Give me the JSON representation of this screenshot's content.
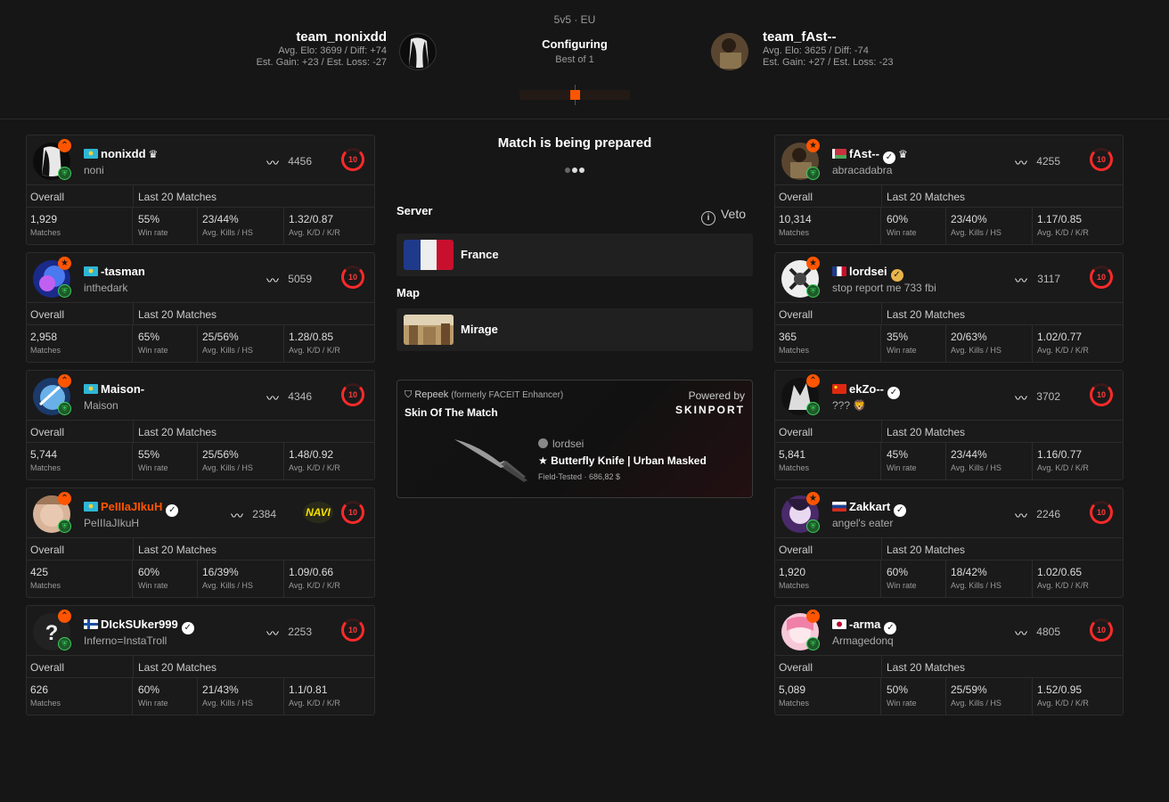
{
  "header": {
    "mode": "5v5 · EU",
    "status": "Configuring",
    "best_of": "Best of 1",
    "team_left": {
      "name": "team_nonixdd",
      "stat1": "Avg. Elo: 3699 / Diff: +74",
      "stat2": "Est. Gain: +23 / Est. Loss: -27"
    },
    "team_right": {
      "name": "team_fAst--",
      "stat1": "Avg. Elo: 3625 / Diff: -74",
      "stat2": "Est. Gain: +27 / Est. Loss: -23"
    }
  },
  "labels": {
    "overall": "Overall",
    "last20": "Last 20 Matches",
    "matches": "Matches",
    "win_rate": "Win rate",
    "avg_kills_hs": "Avg. Kills / HS",
    "avg_kd_kr": "Avg. K/D / K/R",
    "level": "10"
  },
  "left_players": [
    {
      "name": "nonixdd",
      "desc": "noni",
      "elo": "4456",
      "matches": "1,929",
      "win_rate": "55%",
      "kills_hs": "23/44%",
      "kd_kr": "1.32/0.87",
      "flag": "kz",
      "verified": "",
      "crown": true,
      "rank_icon": "chevrons-up-icon"
    },
    {
      "name": "-tasman",
      "desc": "inthedark",
      "elo": "5059",
      "matches": "2,958",
      "win_rate": "65%",
      "kills_hs": "25/56%",
      "kd_kr": "1.28/0.85",
      "flag": "kz",
      "verified": "",
      "crown": false,
      "rank_icon": "star-icon"
    },
    {
      "name": "Maison-",
      "desc": "Maison",
      "elo": "4346",
      "matches": "5,744",
      "win_rate": "55%",
      "kills_hs": "25/56%",
      "kd_kr": "1.48/0.92",
      "flag": "kz",
      "verified": "",
      "crown": false,
      "rank_icon": "chevrons-up-icon"
    },
    {
      "name": "PeIIIaJIkuH",
      "desc": "PeIIIaJIkuH",
      "elo": "2384",
      "matches": "425",
      "win_rate": "60%",
      "kills_hs": "16/39%",
      "kd_kr": "1.09/0.66",
      "flag": "kz",
      "verified": "white",
      "crown": false,
      "rank_icon": "chevrons-up-icon",
      "team_logo": "NAVI"
    },
    {
      "name": "DIckSUker999",
      "desc": "Inferno=InstaTroll",
      "elo": "2253",
      "matches": "626",
      "win_rate": "60%",
      "kills_hs": "21/43%",
      "kd_kr": "1.1/0.81",
      "flag": "fi",
      "verified": "white",
      "crown": false,
      "rank_icon": "chevrons-up-icon"
    }
  ],
  "right_players": [
    {
      "name": "fAst--",
      "desc": "abracadabra",
      "elo": "4255",
      "matches": "10,314",
      "win_rate": "60%",
      "kills_hs": "23/40%",
      "kd_kr": "1.17/0.85",
      "flag": "by",
      "verified": "white",
      "crown": true,
      "rank_icon": "star-icon"
    },
    {
      "name": "lordsei",
      "desc": "stop report me 733 fbi",
      "elo": "3117",
      "matches": "365",
      "win_rate": "35%",
      "kills_hs": "20/63%",
      "kd_kr": "1.02/0.77",
      "flag": "fr",
      "verified": "gold",
      "crown": false,
      "rank_icon": "star-icon"
    },
    {
      "name": "ekZo--",
      "desc": "??? 🦁",
      "elo": "3702",
      "matches": "5,841",
      "win_rate": "45%",
      "kills_hs": "23/44%",
      "kd_kr": "1.16/0.77",
      "flag": "cn",
      "verified": "white",
      "crown": false,
      "rank_icon": "chevrons-up-icon"
    },
    {
      "name": "Zakkart",
      "desc": "angel's eater",
      "elo": "2246",
      "matches": "1,920",
      "win_rate": "60%",
      "kills_hs": "18/42%",
      "kd_kr": "1.02/0.65",
      "flag": "ru",
      "verified": "white",
      "crown": false,
      "rank_icon": "star-icon"
    },
    {
      "name": "-arma",
      "desc": "Armagedonq",
      "elo": "4805",
      "matches": "5,089",
      "win_rate": "50%",
      "kills_hs": "25/59%",
      "kd_kr": "1.52/0.95",
      "flag": "jp",
      "verified": "white",
      "crown": false,
      "rank_icon": "chevrons-up-icon"
    }
  ],
  "center": {
    "preparing": "Match is being prepared",
    "server_label": "Server",
    "veto_label": "Veto",
    "server": "France",
    "map_label": "Map",
    "map": "Mirage"
  },
  "skin": {
    "source": "Repeek",
    "source_note": "(formerly FACEIT Enhancer)",
    "title": "Skin Of The Match",
    "powered_by": "Powered by",
    "brand": "SKINPORT",
    "owner": "lordsei",
    "item": "★ Butterfly Knife | Urban Masked",
    "condition": "Field-Tested · 686,82 $"
  },
  "colors": {
    "accent": "#ff5500",
    "level": "#ff2a2a",
    "background": "#161616",
    "card": "#1a1a1a"
  }
}
